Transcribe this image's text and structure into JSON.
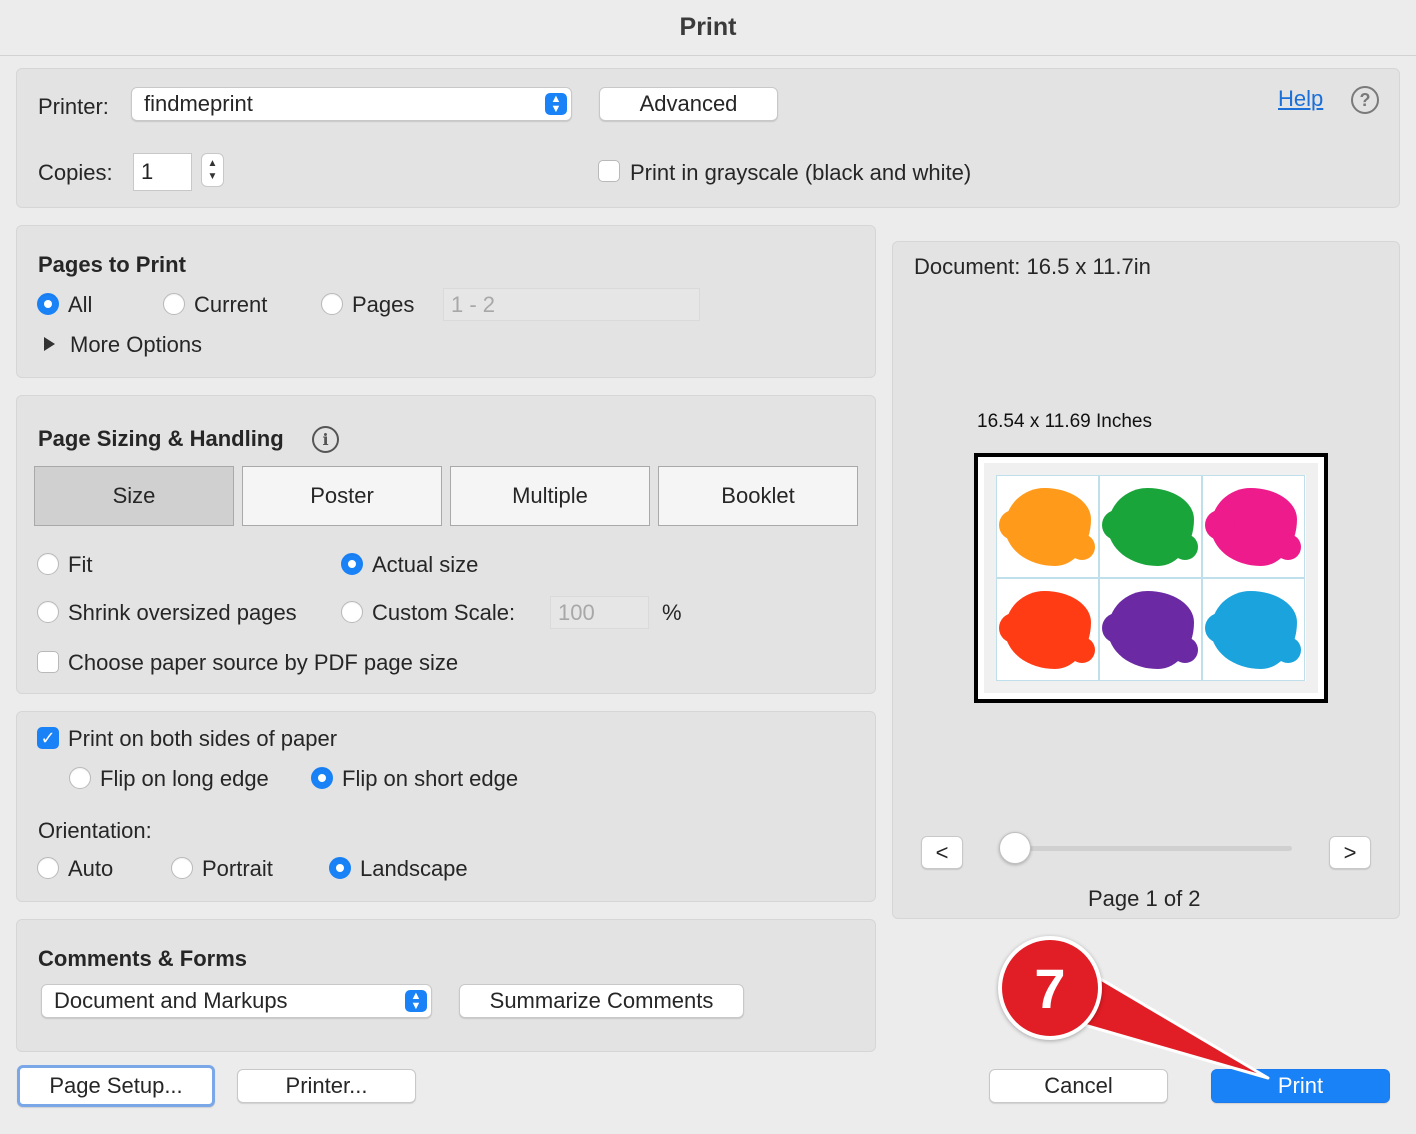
{
  "window": {
    "title": "Print"
  },
  "printer": {
    "printer_label": "Printer:",
    "printer_value": "findmeprint",
    "advanced_label": "Advanced",
    "help_label": "Help",
    "copies_label": "Copies:",
    "copies_value": "1",
    "grayscale_label": "Print in grayscale (black and white)",
    "grayscale_checked": false
  },
  "pages_to_print": {
    "heading": "Pages to Print",
    "options": [
      {
        "label": "All",
        "selected": true
      },
      {
        "label": "Current",
        "selected": false
      },
      {
        "label": "Pages",
        "selected": false
      }
    ],
    "pages_range_placeholder": "1 - 2",
    "more_options_label": "More Options"
  },
  "sizing": {
    "heading": "Page Sizing & Handling",
    "tabs": [
      {
        "label": "Size",
        "selected": true
      },
      {
        "label": "Poster",
        "selected": false
      },
      {
        "label": "Multiple",
        "selected": false
      },
      {
        "label": "Booklet",
        "selected": false
      }
    ],
    "fit_label": "Fit",
    "actual_size_label": "Actual size",
    "shrink_label": "Shrink oversized pages",
    "custom_scale_label": "Custom Scale:",
    "custom_scale_value": "100",
    "percent_label": "%",
    "paper_source_label": "Choose paper source by PDF page size",
    "selected_option": "Actual size"
  },
  "duplex": {
    "both_sides_label": "Print on both sides of paper",
    "both_sides_checked": true,
    "long_edge_label": "Flip on long edge",
    "short_edge_label": "Flip on short edge",
    "selected_flip": "Flip on short edge",
    "orientation_label": "Orientation:",
    "orientation_options": [
      {
        "label": "Auto",
        "selected": false
      },
      {
        "label": "Portrait",
        "selected": false
      },
      {
        "label": "Landscape",
        "selected": true
      }
    ]
  },
  "comments": {
    "heading": "Comments & Forms",
    "select_value": "Document and Markups",
    "summarize_label": "Summarize Comments"
  },
  "preview": {
    "document_label": "Document: 16.5 x 11.7in",
    "size_label": "16.54 x 11.69 Inches",
    "prev_label": "<",
    "next_label": ">",
    "page_label": "Page 1 of 2",
    "page_slider_fraction": 0.0,
    "thumbnail_colors": [
      "#ff9a1a",
      "#1aa53a",
      "#ee1b8c",
      "#ff3c14",
      "#6b2aa3",
      "#1aa3dc"
    ]
  },
  "footer": {
    "page_setup_label": "Page Setup...",
    "printer_button_label": "Printer...",
    "cancel_label": "Cancel",
    "print_label": "Print"
  },
  "annotation": {
    "step_number": "7",
    "color": "#e11d25"
  }
}
